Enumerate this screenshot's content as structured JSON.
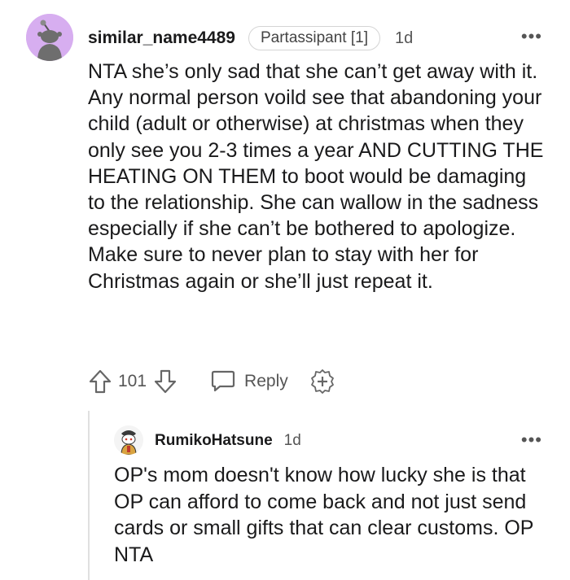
{
  "comment": {
    "username": "similar_name4489",
    "flair": "Partassipant [1]",
    "time": "1d",
    "more_label": "•••",
    "body": "NTA she’s only sad that she can’t get away with it. Any normal person voild see that abandoning your child (adult or otherwise) at christmas when they only see you 2-3 times a year AND CUTTING THE HEATING ON THEM to boot would be damaging to the relationship. She can wallow in the sadness especially if she can’t be bothered to apologize. Make sure to never plan to stay with her for Christmas again or she’ll just repeat it.",
    "votes": "101",
    "reply_label": "Reply",
    "avatar_color": "#d7aef0"
  },
  "reply": {
    "username": "RumikoHatsune",
    "time": "1d",
    "more_label": "•••",
    "body": "OP's mom doesn't know how lucky she is that OP can afford to come back and not just send cards or small gifts that can clear customs. OP NTA"
  },
  "icons": {
    "upvote": "upvote-arrow-icon",
    "downvote": "downvote-arrow-icon",
    "reply": "speech-bubble-icon",
    "award": "plus-award-icon",
    "more": "ellipsis-icon"
  }
}
